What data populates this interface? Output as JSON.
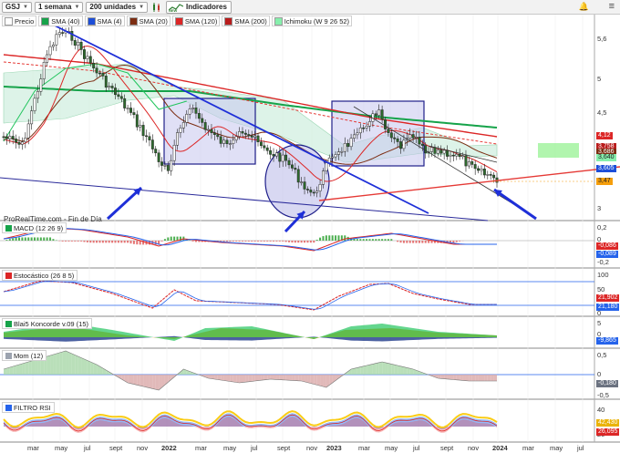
{
  "toolbar": {
    "symbol": "GSJ",
    "timeframe": "1 semana",
    "units": "200 unidades",
    "indicators_label": "Indicadores"
  },
  "legend": [
    {
      "label": "Precio",
      "color": "#ffffff"
    },
    {
      "label": "SMA (40)",
      "color": "#16a34a"
    },
    {
      "label": "SMA (4)",
      "color": "#1d4ed8"
    },
    {
      "label": "SMA (20)",
      "color": "#7c2d12"
    },
    {
      "label": "SMA (120)",
      "color": "#dc2626"
    },
    {
      "label": "SMA (200)",
      "color": "#b91c1c"
    },
    {
      "label": "Ichimoku (W 9 26 52)",
      "color": "#86efac"
    }
  ],
  "watermark": "ProRealTime.com - Fin de Día",
  "price_axis": [
    "5,6",
    "5",
    "4,5",
    "4",
    "3,5",
    "3"
  ],
  "price_tags": [
    {
      "text": "4,12",
      "color": "#dc2626"
    },
    {
      "text": "3,758",
      "color": "#b91c1c"
    },
    {
      "text": "3,686",
      "color": "#7c2d12"
    },
    {
      "text": "3,640",
      "color": "#86efac"
    },
    {
      "text": "3,605",
      "color": "#1d4ed8"
    },
    {
      "text": "3,47",
      "color": "#f59e0b"
    }
  ],
  "panels": {
    "macd": {
      "title": "MACD (12 26 9)",
      "axis": [
        "0,2",
        "0",
        "-0,2"
      ],
      "tags": [
        "-0,086",
        "-0,089"
      ]
    },
    "stoch": {
      "title": "Estocástico (26 8 5)",
      "axis": [
        "100",
        "50",
        "0"
      ],
      "tags": [
        "21,902",
        "21,180"
      ]
    },
    "blai": {
      "title": "Blai5 Koncorde v.09 (15)",
      "axis": [
        "5",
        "0"
      ],
      "tags": [
        "-9,865"
      ]
    },
    "mom": {
      "title": "Mom (12)",
      "axis": [
        "0,5",
        "0",
        "-0,5"
      ],
      "tags": [
        "-0,180"
      ]
    },
    "rsi": {
      "title": "FILTRO RSI",
      "axis": [
        "40",
        "20"
      ],
      "tags": [
        "42,430",
        "26,095"
      ]
    }
  },
  "x_axis": [
    {
      "label": "mar",
      "bold": false
    },
    {
      "label": "may",
      "bold": false
    },
    {
      "label": "jul",
      "bold": false
    },
    {
      "label": "sept",
      "bold": false
    },
    {
      "label": "nov",
      "bold": false
    },
    {
      "label": "2022",
      "bold": true
    },
    {
      "label": "mar",
      "bold": false
    },
    {
      "label": "may",
      "bold": false
    },
    {
      "label": "jul",
      "bold": false
    },
    {
      "label": "sept",
      "bold": false
    },
    {
      "label": "nov",
      "bold": false
    },
    {
      "label": "2023",
      "bold": true
    },
    {
      "label": "mar",
      "bold": false
    },
    {
      "label": "may",
      "bold": false
    },
    {
      "label": "jul",
      "bold": false
    },
    {
      "label": "sept",
      "bold": false
    },
    {
      "label": "nov",
      "bold": false
    },
    {
      "label": "2024",
      "bold": true
    },
    {
      "label": "mar",
      "bold": false
    },
    {
      "label": "may",
      "bold": false
    },
    {
      "label": "jul",
      "bold": false
    }
  ],
  "icons": {
    "bell": "bell-icon",
    "menu": "hamburger-menu-icon"
  }
}
